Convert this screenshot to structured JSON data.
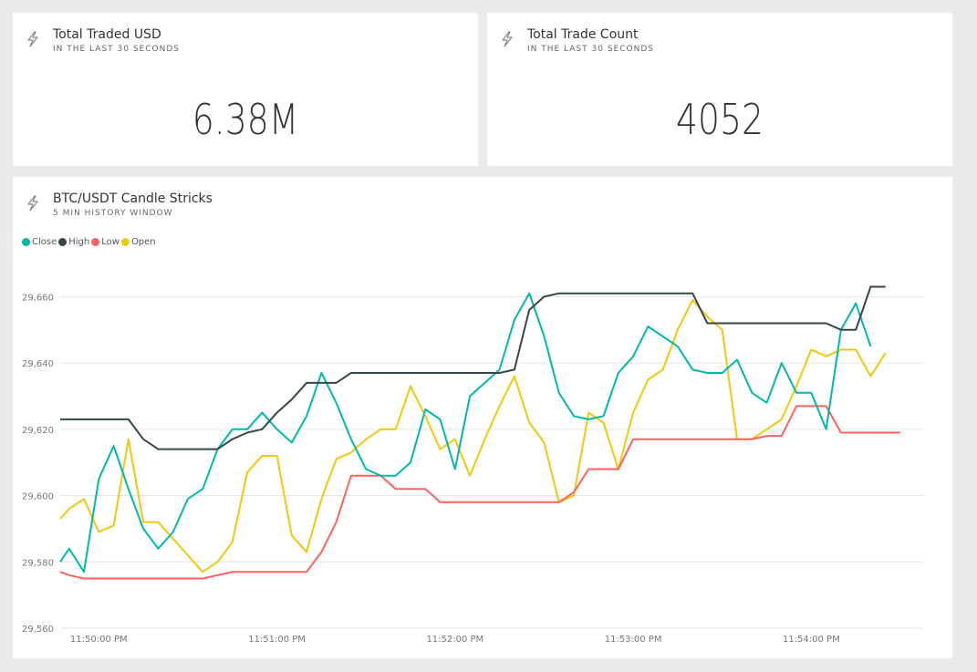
{
  "tiles": {
    "traded_usd": {
      "title": "Total Traded USD",
      "subtitle": "IN THE LAST 30 SECONDS",
      "value": "6.38M",
      "icon": "lightning-icon"
    },
    "trade_count": {
      "title": "Total Trade Count",
      "subtitle": "IN THE LAST 30 SECONDS",
      "value": "4052",
      "icon": "lightning-icon"
    },
    "candles": {
      "title": "BTC/USDT Candle Stricks",
      "subtitle": "5 MIN HISTORY WINDOW",
      "icon": "lightning-icon"
    }
  },
  "colors": {
    "Close": "#01b8aa",
    "High": "#374649",
    "Low": "#fd625e",
    "Open": "#f2c80f",
    "background": "#eaeaea",
    "tile": "#ffffff",
    "grid": "#e6e6e6"
  },
  "chart_data": {
    "type": "line",
    "title": "BTC/USDT Candle Stricks",
    "subtitle": "5 MIN HISTORY WINDOW",
    "legend_position": "top-left",
    "grid": true,
    "ylim": [
      29560,
      29670
    ],
    "y_ticks": [
      "29,560",
      "29,580",
      "29,600",
      "29,620",
      "29,640",
      "29,660"
    ],
    "y_tick_values": [
      29560,
      29580,
      29600,
      29620,
      29640,
      29660
    ],
    "x_ticks": [
      "11:50:00 PM",
      "11:51:00 PM",
      "11:52:00 PM",
      "11:53:00 PM",
      "11:54:00 PM"
    ],
    "x_tick_seconds": [
      0,
      60,
      120,
      180,
      240
    ],
    "x_seconds": [
      -13,
      -10,
      -5,
      0,
      5,
      10,
      15,
      20,
      25,
      30,
      35,
      40,
      45,
      50,
      55,
      60,
      65,
      70,
      75,
      80,
      85,
      90,
      95,
      100,
      105,
      110,
      115,
      120,
      125,
      130,
      135,
      140,
      145,
      150,
      155,
      160,
      165,
      170,
      175,
      180,
      185,
      190,
      195,
      200,
      205,
      210,
      215,
      220,
      225,
      230,
      235,
      240,
      245,
      250,
      255,
      260,
      265,
      270,
      275,
      278
    ],
    "series": [
      {
        "name": "Close",
        "values": [
          29580,
          29584,
          29577,
          29605,
          29615,
          29602,
          29590,
          29584,
          29589,
          29599,
          29602,
          29614,
          29620,
          29620,
          29625,
          29620,
          29616,
          29624,
          29637,
          29628,
          29617,
          29608,
          29606,
          29606,
          29610,
          29626,
          29623,
          29608,
          29630,
          29634,
          29638,
          29653,
          29661,
          29648,
          29631,
          29624,
          29623,
          29624,
          29637,
          29642,
          29651,
          29648,
          29645,
          29638,
          29637,
          29637,
          29641,
          29631,
          29628,
          29640,
          29631,
          29631,
          29620,
          29650,
          29658,
          29645,
          null,
          null,
          null,
          null
        ]
      },
      {
        "name": "High",
        "values": [
          29623,
          29623,
          29623,
          29623,
          29623,
          29623,
          29617,
          29614,
          29614,
          29614,
          29614,
          29614,
          29617,
          29619,
          29620,
          29625,
          29629,
          29634,
          29634,
          29634,
          29637,
          29637,
          29637,
          29637,
          29637,
          29637,
          29637,
          29637,
          29637,
          29637,
          29637,
          29638,
          29656,
          29660,
          29661,
          29661,
          29661,
          29661,
          29661,
          29661,
          29661,
          29661,
          29661,
          29661,
          29652,
          29652,
          29652,
          29652,
          29652,
          29652,
          29652,
          29652,
          29652,
          29650,
          29650,
          29663,
          29663,
          null,
          null,
          null
        ]
      },
      {
        "name": "Low",
        "values": [
          29577,
          29576,
          29575,
          29575,
          29575,
          29575,
          29575,
          29575,
          29575,
          29575,
          29575,
          29576,
          29577,
          29577,
          29577,
          29577,
          29577,
          29577,
          29583,
          29592,
          29606,
          29606,
          29606,
          29602,
          29602,
          29602,
          29598,
          29598,
          29598,
          29598,
          29598,
          29598,
          29598,
          29598,
          29598,
          29601,
          29608,
          29608,
          29608,
          29617,
          29617,
          29617,
          29617,
          29617,
          29617,
          29617,
          29617,
          29617,
          29618,
          29618,
          29627,
          29627,
          29627,
          29619,
          29619,
          29619,
          29619,
          29619,
          null,
          null
        ]
      },
      {
        "name": "Open",
        "values": [
          29593,
          29596,
          29599,
          29589,
          29591,
          29617,
          29592,
          29592,
          29587,
          29582,
          29577,
          29580,
          29586,
          29607,
          29612,
          29612,
          29588,
          29583,
          29599,
          29611,
          29613,
          29617,
          29620,
          29620,
          29633,
          29624,
          29614,
          29617,
          29606,
          29617,
          29627,
          29636,
          29622,
          29616,
          29598,
          29600,
          29625,
          29622,
          29608,
          29625,
          29635,
          29638,
          29650,
          29659,
          29654,
          29650,
          29617,
          29617,
          29620,
          29623,
          29633,
          29644,
          29642,
          29644,
          29644,
          29636,
          29643,
          null,
          null,
          null
        ]
      }
    ]
  }
}
